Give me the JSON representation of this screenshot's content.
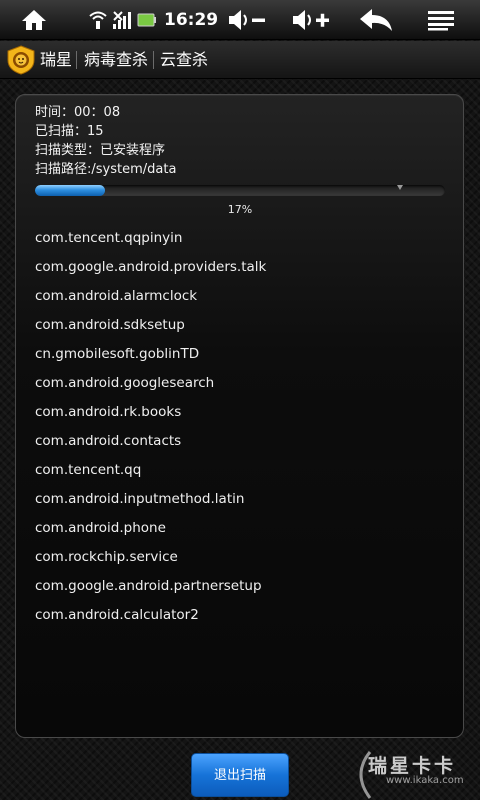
{
  "status_bar": {
    "time": "16:29",
    "icons": [
      "home-icon",
      "wifi-icon",
      "signal-icon",
      "battery-icon",
      "volume-down-icon",
      "volume-up-icon",
      "back-icon",
      "menu-icon"
    ]
  },
  "title_bar": {
    "app_name": "瑞星",
    "tabs": [
      "病毒查杀",
      "云查杀"
    ]
  },
  "scan": {
    "time": "时间：00：08",
    "scanned": "已扫描：15",
    "type": "扫描类型：已安装程序",
    "path": "扫描路径:/system/data",
    "progress": 0.17,
    "progress_label": "17%"
  },
  "packages": [
    "com.tencent.qqpinyin",
    "com.google.android.providers.talk",
    "com.android.alarmclock",
    "com.android.sdksetup",
    "cn.gmobilesoft.goblinTD",
    "com.android.googlesearch",
    "com.android.rk.books",
    "com.android.contacts",
    "com.tencent.qq",
    "com.android.inputmethod.latin",
    "com.android.phone",
    "com.rockchip.service",
    "com.google.android.partnersetup",
    "com.android.calculator2"
  ],
  "exit_button": "退出扫描",
  "watermark": {
    "title": "瑞星卡卡",
    "url": "www.ikaka.com"
  },
  "colors": {
    "progress": "#2e8fe0",
    "button": "#1673d8"
  }
}
